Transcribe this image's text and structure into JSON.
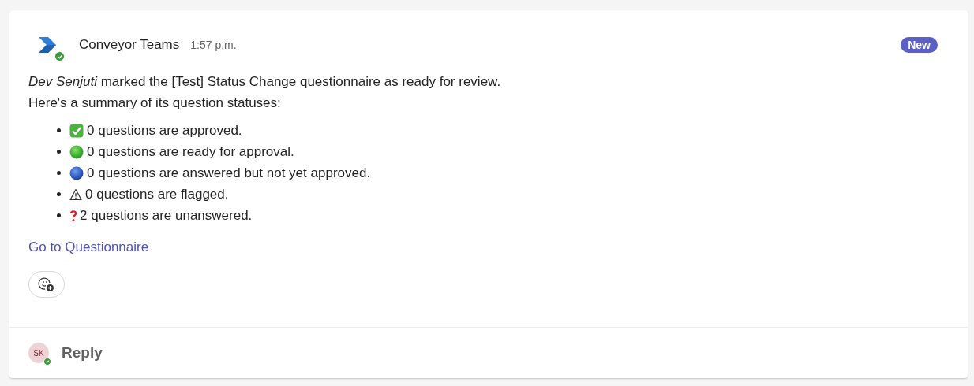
{
  "message": {
    "sender": "Conveyor Teams",
    "sender_online": true,
    "time": "1:57 p.m.",
    "badge": "New",
    "intro": "*Dev Senjuti* marked the [Test] Status Change questionnaire as ready for review.",
    "summary_heading": "Here's a summary of its question statuses:",
    "statuses": [
      {
        "kind": "check",
        "text": "0 questions are approved."
      },
      {
        "kind": "green",
        "text": "0 questions are ready for approval."
      },
      {
        "kind": "blue",
        "text": "0 questions are answered but not yet approved."
      },
      {
        "kind": "warning",
        "text": "0 questions are flagged."
      },
      {
        "kind": "question",
        "text": "2 questions are unanswered."
      }
    ],
    "link": "Go to Questionnaire"
  },
  "reply": {
    "initials": "SK",
    "online": true,
    "label": "Reply"
  }
}
